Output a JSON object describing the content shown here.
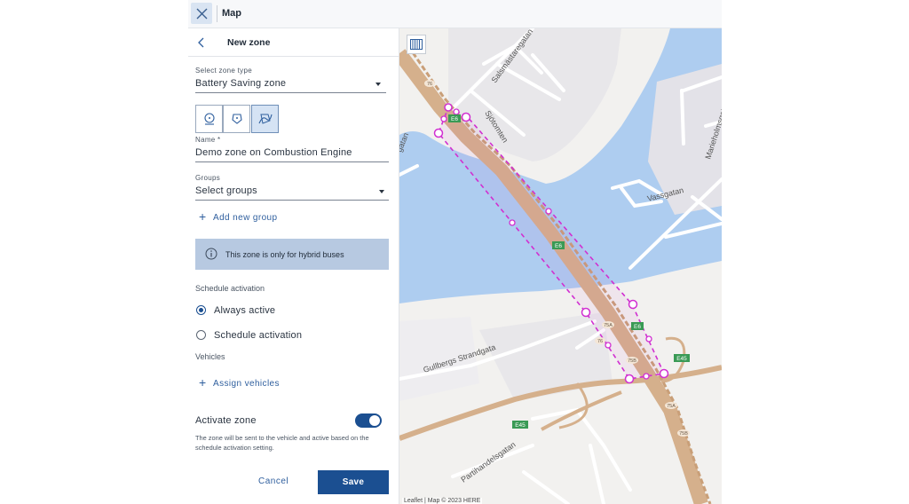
{
  "header": {
    "title": "Map"
  },
  "panel": {
    "title": "New zone",
    "zone_type": {
      "label": "Select zone type",
      "value": "Battery Saving zone"
    },
    "name": {
      "label": "Name *",
      "value": "Demo zone on Combustion Engine"
    },
    "groups": {
      "label": "Groups",
      "value": "Select groups"
    },
    "add_group": "Add new group",
    "info": "This zone is only for hybrid buses",
    "schedule": {
      "heading": "Schedule activation",
      "options": [
        "Always active",
        "Schedule activation"
      ],
      "selected": "Always active"
    },
    "vehicles": {
      "heading": "Vehicles",
      "assign": "Assign vehicles"
    },
    "activate": {
      "label": "Activate zone",
      "on": true,
      "help": "The zone will be sent to the vehicle and active based on the schedule activation setting."
    },
    "cancel": "Cancel",
    "save": "Save"
  },
  "map": {
    "attribution": "Leaflet | Map © 2023 HERE",
    "streets": [
      "Salsmästaregatan",
      "Sjötomten",
      "Vassgatan",
      "Marieholmsgatan",
      "Gullbergs Strandgata",
      "Partihandelsgatan",
      "gatan"
    ],
    "road_shields": [
      "E6",
      "E6",
      "E6",
      "E45",
      "E45",
      "76",
      "76",
      "75A",
      "75A",
      "75B",
      "75B"
    ],
    "colors": {
      "water": "#aecdf0",
      "land": "#f2f1ef",
      "motorway": "#d5b08c",
      "zone": "#d12fd1"
    }
  },
  "colors": {
    "accent": "#1b4f91",
    "info_bg": "#b7c9e1",
    "segment_selected": "#d5e3f4"
  }
}
